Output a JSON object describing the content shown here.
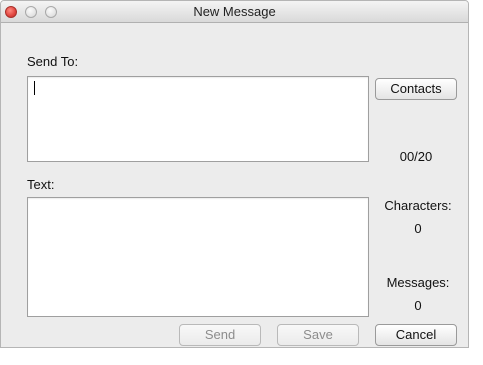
{
  "window": {
    "title": "New Message"
  },
  "labels": {
    "send_to": "Send To:",
    "text": "Text:"
  },
  "send_to_field": {
    "value": ""
  },
  "text_field": {
    "value": ""
  },
  "buttons": {
    "contacts": "Contacts",
    "send": "Send",
    "save": "Save",
    "cancel": "Cancel"
  },
  "stats": {
    "recipient_count": "00/20",
    "characters_label": "Characters:",
    "characters_value": "0",
    "messages_label": "Messages:",
    "messages_value": "0"
  }
}
